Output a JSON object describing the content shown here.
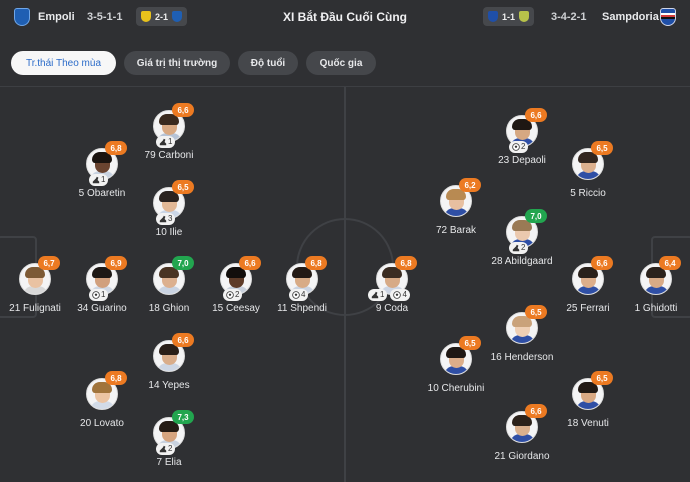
{
  "header": {
    "home_name": "Empoli",
    "home_formation": "3-5-1-1",
    "home_last_result": "2-1",
    "title": "XI Bắt Đầu Cuối Cùng",
    "away_last_result": "1-1",
    "away_formation": "3-4-2-1",
    "away_name": "Sampdoria"
  },
  "colors": {
    "background": "#2f3033",
    "rating_orange": "#ec7a22",
    "rating_green": "#22a54f",
    "tab_active_text": "#2c6cc9"
  },
  "tabs": [
    {
      "label": "Tr.thái Theo mùa",
      "active": true
    },
    {
      "label": "Giá trị thị trường",
      "active": false
    },
    {
      "label": "Độ tuổi",
      "active": false
    },
    {
      "label": "Quốc gia",
      "active": false
    }
  ],
  "players": [
    {
      "id": "carboni",
      "name": "79 Carboni",
      "rating": "6,6",
      "rating_color": "orange",
      "events": [
        {
          "icon": "boot-icon",
          "count": "1"
        }
      ]
    },
    {
      "id": "obaretin",
      "name": "5 Obaretin",
      "rating": "6,8",
      "rating_color": "orange",
      "events": [
        {
          "icon": "boot-icon",
          "count": "1"
        }
      ]
    },
    {
      "id": "ilie",
      "name": "10 Ilie",
      "rating": "6,5",
      "rating_color": "orange",
      "events": [
        {
          "icon": "boot-icon",
          "count": "3"
        }
      ]
    },
    {
      "id": "fulignati",
      "name": "21 Fulignati",
      "rating": "6,7",
      "rating_color": "orange",
      "events": []
    },
    {
      "id": "guarino",
      "name": "34 Guarino",
      "rating": "6,9",
      "rating_color": "orange",
      "events": [
        {
          "icon": "ball-icon",
          "count": "1"
        }
      ]
    },
    {
      "id": "ghion",
      "name": "18 Ghion",
      "rating": "7,0",
      "rating_color": "green",
      "events": []
    },
    {
      "id": "ceesay",
      "name": "15 Ceesay",
      "rating": "6,6",
      "rating_color": "orange",
      "events": [
        {
          "icon": "ball-icon",
          "count": "2"
        }
      ]
    },
    {
      "id": "shpendi",
      "name": "11 Shpendi",
      "rating": "6,8",
      "rating_color": "orange",
      "events": [
        {
          "icon": "ball-icon",
          "count": "4"
        }
      ]
    },
    {
      "id": "yepes",
      "name": "14 Yepes",
      "rating": "6,6",
      "rating_color": "orange",
      "events": []
    },
    {
      "id": "lovato",
      "name": "20 Lovato",
      "rating": "6,8",
      "rating_color": "orange",
      "events": []
    },
    {
      "id": "elia",
      "name": "7 Elia",
      "rating": "7,3",
      "rating_color": "green",
      "events": [
        {
          "icon": "boot-icon",
          "count": "2"
        }
      ]
    },
    {
      "id": "coda",
      "name": "9 Coda",
      "rating": "6,8",
      "rating_color": "orange",
      "events": [
        {
          "icon": "boot-icon",
          "count": "1"
        },
        {
          "icon": "ball-icon",
          "count": "4"
        }
      ]
    },
    {
      "id": "depaoli",
      "name": "23 Depaoli",
      "rating": "6,6",
      "rating_color": "orange",
      "events": [
        {
          "icon": "ball-icon",
          "count": "2"
        }
      ]
    },
    {
      "id": "riccio",
      "name": "5 Riccio",
      "rating": "6,5",
      "rating_color": "orange",
      "events": []
    },
    {
      "id": "barak",
      "name": "72 Barak",
      "rating": "6,2",
      "rating_color": "orange",
      "events": []
    },
    {
      "id": "abildgaard",
      "name": "28 Abildgaard",
      "rating": "7,0",
      "rating_color": "green",
      "events": [
        {
          "icon": "boot-icon",
          "count": "2"
        }
      ]
    },
    {
      "id": "ferrari",
      "name": "25 Ferrari",
      "rating": "6,6",
      "rating_color": "orange",
      "events": []
    },
    {
      "id": "ghidotti",
      "name": "1 Ghidotti",
      "rating": "6,4",
      "rating_color": "orange",
      "events": []
    },
    {
      "id": "henderson",
      "name": "16 Henderson",
      "rating": "6,5",
      "rating_color": "orange",
      "events": []
    },
    {
      "id": "cherubini",
      "name": "10 Cherubini",
      "rating": "6,5",
      "rating_color": "orange",
      "events": []
    },
    {
      "id": "venuti",
      "name": "18 Venuti",
      "rating": "6,5",
      "rating_color": "orange",
      "events": []
    },
    {
      "id": "giordano",
      "name": "21 Giordano",
      "rating": "6,6",
      "rating_color": "orange",
      "events": []
    }
  ]
}
